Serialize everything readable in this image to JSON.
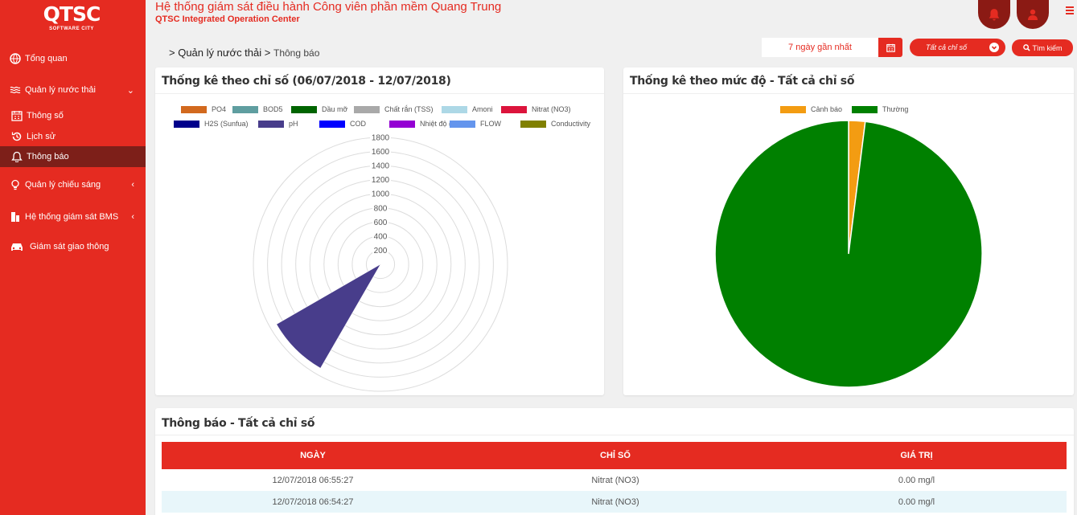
{
  "logo": {
    "mark": "QTSC",
    "sub": "SOFTWARE CITY"
  },
  "header": {
    "title": "Hệ thống giám sát điều hành Công viên phần mềm Quang Trung",
    "subtitle": "QTSC Integrated Operation Center"
  },
  "sidebar": {
    "items": [
      {
        "label": "Tổng quan",
        "icon": "globe-icon"
      },
      {
        "label": "Quản lý nước thải",
        "icon": "waves-icon"
      },
      {
        "label": "Thông số",
        "icon": "calendar-icon"
      },
      {
        "label": "Lịch sử",
        "icon": "history-icon"
      },
      {
        "label": "Thông báo",
        "icon": "bell-icon"
      },
      {
        "label": "Quản lý chiếu sáng",
        "icon": "lightbulb-icon"
      },
      {
        "label": "Hệ thống giám sát BMS",
        "icon": "building-icon"
      },
      {
        "label": "Giám sát giao thông",
        "icon": "car-icon"
      }
    ]
  },
  "breadcrumb": {
    "part1": "> Quản lý nước thải >",
    "part2": "Thông báo"
  },
  "filters": {
    "date_range": "7 ngày gần nhất",
    "metric": "Tất cả chỉ số",
    "search_label": "Tìm kiếm"
  },
  "radar_panel": {
    "title": "Thống kê theo chỉ số (06/07/2018 - 12/07/2018)",
    "legend": [
      {
        "name": "PO4",
        "color": "#d2691e"
      },
      {
        "name": "BOD5",
        "color": "#5f9ea0"
      },
      {
        "name": "Dầu mỡ",
        "color": "#006400"
      },
      {
        "name": "Chất rắn (TSS)",
        "color": "#a9a9a9"
      },
      {
        "name": "Amoni",
        "color": "#add8e6"
      },
      {
        "name": "Nitrat (NO3)",
        "color": "#dc143c"
      },
      {
        "name": "H2S (Sunfua)",
        "color": "#00008b"
      },
      {
        "name": "pH",
        "color": "#483d8b"
      },
      {
        "name": "COD",
        "color": "#0000ff"
      },
      {
        "name": "Nhiệt độ (Temp)",
        "color": "#9400d3"
      },
      {
        "name": "FLOW",
        "color": "#6495ed"
      },
      {
        "name": "Conductivity",
        "color": "#808000"
      }
    ]
  },
  "pie_panel": {
    "title": "Thống kê theo mức độ - Tất cả chỉ số",
    "legend": [
      {
        "name": "Cảnh báo",
        "color": "#f39c12"
      },
      {
        "name": "Thường",
        "color": "#008000"
      }
    ]
  },
  "chart_data": [
    {
      "type": "polar-area",
      "categories": [
        "PO4",
        "BOD5",
        "Dầu mỡ",
        "Chất rắn (TSS)",
        "Amoni",
        "Nitrat (NO3)",
        "H2S (Sunfua)",
        "pH",
        "COD",
        "Nhiệt độ (Temp)",
        "FLOW",
        "Conductivity"
      ],
      "values": [
        0,
        0,
        0,
        0,
        0,
        10,
        0,
        1700,
        0,
        0,
        0,
        0
      ],
      "rlim": [
        0,
        1800
      ],
      "ticks": [
        "200",
        "400",
        "600",
        "800",
        "1000",
        "1200",
        "1400",
        "1600",
        "1800"
      ],
      "legend_position": "top"
    },
    {
      "type": "pie",
      "categories": [
        "Cảnh báo",
        "Thường"
      ],
      "values": [
        2,
        98
      ],
      "legend_position": "top"
    }
  ],
  "table": {
    "title": "Thông báo - Tất cả chỉ số",
    "headers": [
      "NGÀY",
      "CHỈ SỐ",
      "GIÁ TRỊ"
    ],
    "rows": [
      [
        "12/07/2018 06:55:27",
        "Nitrat (NO3)",
        "0.00 mg/l"
      ],
      [
        "12/07/2018 06:54:27",
        "Nitrat (NO3)",
        "0.00 mg/l"
      ]
    ]
  },
  "colors": {
    "accent": "#e52b21",
    "sidebar_active": "#7d1f19",
    "header_button": "#8b1a14"
  }
}
